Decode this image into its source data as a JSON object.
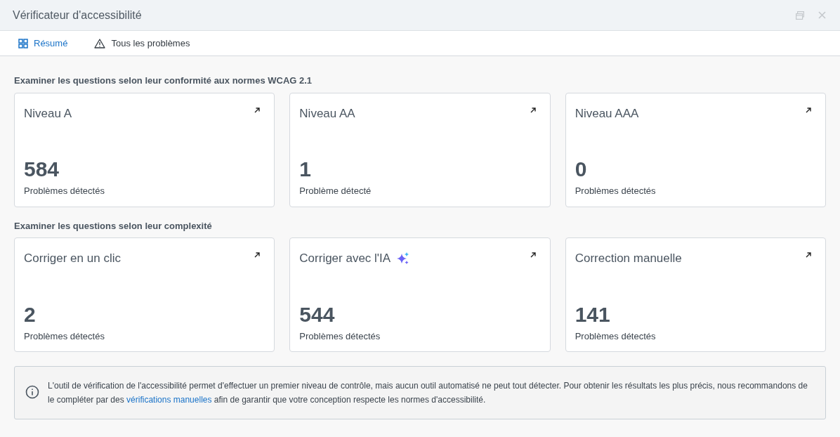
{
  "window": {
    "title": "Vérificateur d'accessibilité"
  },
  "tabs": [
    {
      "label": "Résumé",
      "kind": "grid",
      "selected": true
    },
    {
      "label": "Tous les problèmes",
      "kind": "warning",
      "selected": false
    }
  ],
  "sections": [
    {
      "heading": "Examiner les questions selon leur conformité aux normes WCAG 2.1",
      "cards": [
        {
          "title": "Niveau A",
          "ai": false,
          "count": "584",
          "caption": "Problèmes détectés"
        },
        {
          "title": "Niveau AA",
          "ai": false,
          "count": "1",
          "caption": "Problème détecté"
        },
        {
          "title": "Niveau AAA",
          "ai": false,
          "count": "0",
          "caption": "Problèmes détectés"
        }
      ]
    },
    {
      "heading": "Examiner les questions selon leur complexité",
      "cards": [
        {
          "title": "Corriger en un clic",
          "ai": false,
          "count": "2",
          "caption": "Problèmes détectés"
        },
        {
          "title": "Corriger avec l'IA",
          "ai": true,
          "count": "544",
          "caption": "Problèmes détectés"
        },
        {
          "title": "Correction manuelle",
          "ai": false,
          "count": "141",
          "caption": "Problèmes détectés"
        }
      ]
    }
  ],
  "notice": {
    "before": "L'outil de vérification de l'accessibilité permet d'effectuer un premier niveau de contrôle, mais aucun outil automatisé ne peut tout détecter. Pour obtenir les résultats les plus précis, nous recommandons de le compléter par des",
    "link": "vérifications manuelles",
    "after": "afin de garantir que votre conception respecte les normes d'accessibilité."
  }
}
